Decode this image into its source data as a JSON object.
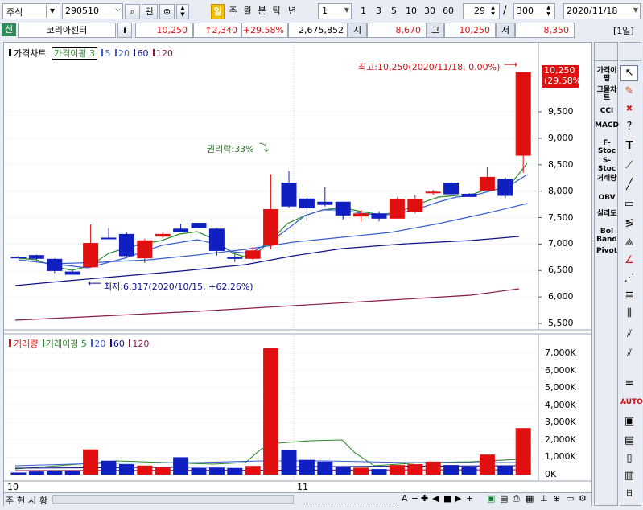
{
  "toolbar": {
    "market": "주식",
    "code": "290510",
    "btn_gwan": "관",
    "period_selected": "일",
    "periods": [
      "주",
      "월",
      "분",
      "틱",
      "년"
    ],
    "interval_value": "1",
    "quick": [
      "1",
      "3",
      "5",
      "10",
      "30",
      "60"
    ],
    "count_value": "29",
    "count_sep": "/",
    "count_total": "300",
    "date": "2020/11/18"
  },
  "quote": {
    "badge": "신",
    "name": "코리아센터",
    "info": "i",
    "price": "10,250",
    "change": "↑2,340",
    "change_pct": "+29.58%",
    "volume": "2,675,852",
    "open_label": "시",
    "open": "8,670",
    "high_label": "고",
    "high": "10,250",
    "low_label": "저",
    "low": "8,350",
    "period_tag": "[1일]"
  },
  "price_legend": {
    "title": "가격차트",
    "ma_box": "가격이평 3",
    "ma": [
      "5",
      "20",
      "60",
      "120"
    ]
  },
  "volume_legend": {
    "title": "거래량",
    "ma_label": "거래이평 5",
    "ma": [
      "20",
      "60",
      "120"
    ]
  },
  "annotations": {
    "high": "최고:10,250(2020/11/18, 0.00%)",
    "low": "최저:6,317(2020/10/15, +62.26%)",
    "rights": "권리락:33%",
    "last_price": "10,250",
    "last_pct": "(29.58%)"
  },
  "price_axis": [
    "9,500",
    "9,000",
    "8,500",
    "8,000",
    "7,500",
    "7,000",
    "6,500",
    "6,000",
    "5,500"
  ],
  "volume_axis": [
    "7,000K",
    "6,000K",
    "5,000K",
    "4,000K",
    "3,000K",
    "2,000K",
    "1,000K",
    "0K"
  ],
  "x_labels": [
    "10",
    "11"
  ],
  "bottom_tabs": [
    "주",
    "현",
    "시",
    "황"
  ],
  "indicators": [
    "가격이평",
    "그물차트",
    "CCI",
    "MACD",
    "F-Stoc",
    "S-Stoc",
    "거래량",
    "OBV",
    "실리도",
    "Bol Band",
    "Pivot"
  ],
  "tool_icons": [
    "cursor-icon",
    "eraser-icon",
    "delete-all-icon",
    "help-icon",
    "text-icon",
    "trend-icon",
    "line-icon",
    "rect-icon",
    "fibo-icon",
    "gann-icon",
    "cycle-icon",
    "color-icon",
    "auto-icon",
    "window-icon",
    "print-icon",
    "chart-icon",
    "day-icon"
  ],
  "colors": {
    "up": "#e01010",
    "down": "#1020c0",
    "ma5": "#2a8a2a",
    "ma20": "#3a5fd0",
    "ma60": "#10108a",
    "ma120": "#8a1a4a"
  }
}
